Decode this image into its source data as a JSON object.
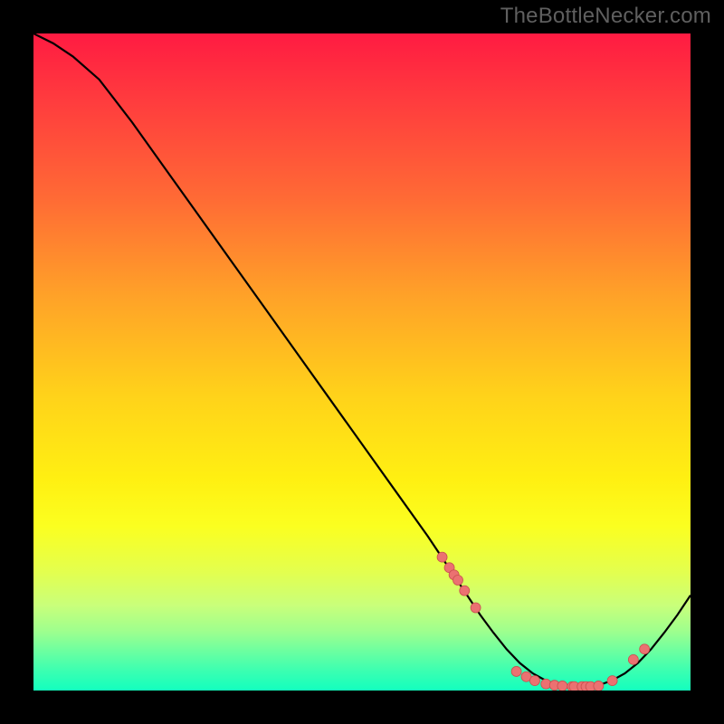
{
  "watermark": "TheBottleNecker.com",
  "colors": {
    "page_bg": "#000000",
    "curve": "#000000",
    "marker_fill": "#eb7171",
    "marker_stroke": "#c94f4f",
    "watermark": "#5f5f5f"
  },
  "chart_data": {
    "type": "line",
    "title": "",
    "xlabel": "",
    "ylabel": "",
    "xlim": [
      0,
      100
    ],
    "ylim": [
      0,
      100
    ],
    "x": [
      0,
      3,
      6,
      10,
      15,
      20,
      25,
      30,
      35,
      40,
      45,
      50,
      55,
      60,
      62,
      64,
      66,
      68,
      70,
      72,
      74,
      76,
      78,
      80,
      82,
      84,
      86,
      88,
      90,
      92,
      94,
      96,
      98,
      100
    ],
    "y": [
      100,
      98.5,
      96.5,
      93,
      86.5,
      79.5,
      72.5,
      65.5,
      58.5,
      51.5,
      44.5,
      37.5,
      30.5,
      23.5,
      20.5,
      17.5,
      14.5,
      11.5,
      8.8,
      6.3,
      4.2,
      2.6,
      1.5,
      0.8,
      0.5,
      0.5,
      0.8,
      1.5,
      2.6,
      4.2,
      6.3,
      8.8,
      11.5,
      14.5
    ],
    "markers_x": [
      62.2,
      63.3,
      64.0,
      64.6,
      65.6,
      67.3,
      73.5,
      75.0,
      76.3,
      78.0,
      79.3,
      80.5,
      82.0,
      82.3,
      83.5,
      84.1,
      84.8,
      86.0,
      88.1,
      91.3,
      93.0
    ],
    "markers_y": [
      20.3,
      18.7,
      17.6,
      16.8,
      15.2,
      12.6,
      2.9,
      2.1,
      1.5,
      1.0,
      0.8,
      0.7,
      0.6,
      0.6,
      0.6,
      0.6,
      0.6,
      0.7,
      1.5,
      4.7,
      6.3
    ]
  }
}
